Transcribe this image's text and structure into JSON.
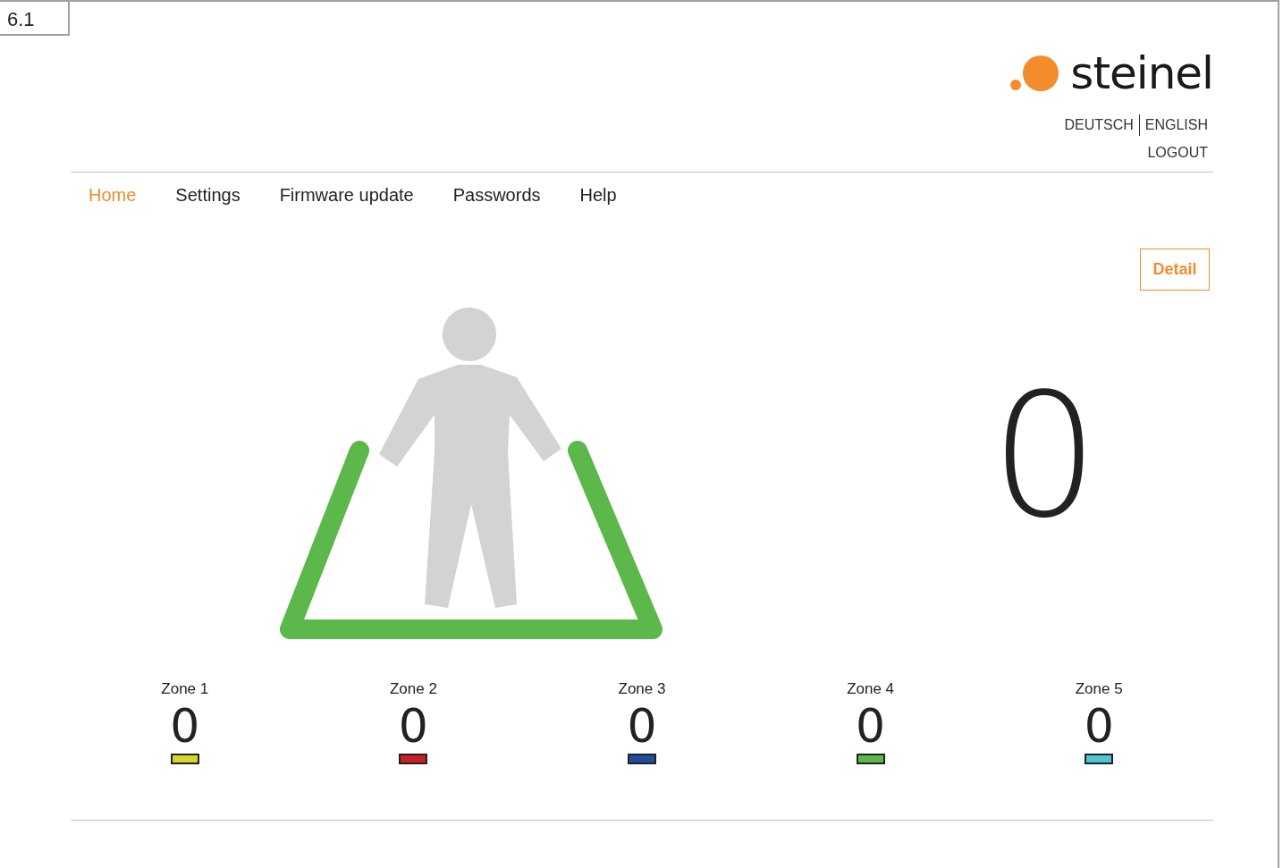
{
  "figure_label": "6.1",
  "logo": {
    "text": "steinel"
  },
  "languages": [
    "DEUTSCH",
    "ENGLISH"
  ],
  "logout": "LOGOUT",
  "nav": [
    {
      "label": "Home",
      "selected": true
    },
    {
      "label": "Settings",
      "selected": false
    },
    {
      "label": "Firmware update",
      "selected": false
    },
    {
      "label": "Passwords",
      "selected": false
    },
    {
      "label": "Help",
      "selected": false
    }
  ],
  "detail_button": "Detail",
  "total_count": "0",
  "zones": [
    {
      "label": "Zone 1",
      "count": "0",
      "color": "#d6d62a"
    },
    {
      "label": "Zone 2",
      "count": "0",
      "color": "#c81e2a"
    },
    {
      "label": "Zone 3",
      "count": "0",
      "color": "#1f4c9e"
    },
    {
      "label": "Zone 4",
      "count": "0",
      "color": "#5cb84a"
    },
    {
      "label": "Zone 5",
      "count": "0",
      "color": "#4ec6d6"
    }
  ]
}
